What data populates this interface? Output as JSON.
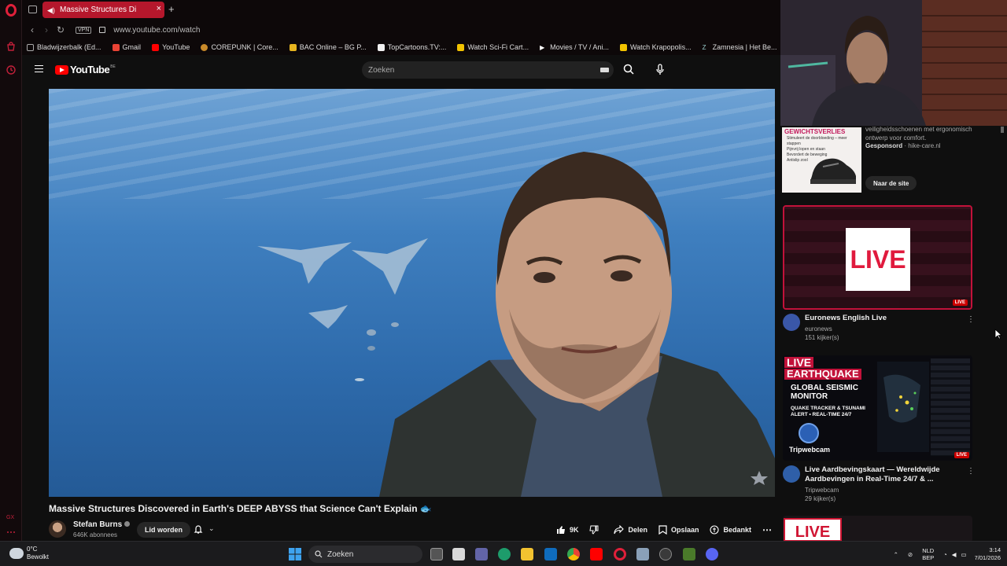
{
  "browser": {
    "tab_title": "Massive Structures Di",
    "url": "www.youtube.com/watch",
    "vpn_label": "VPN",
    "bookmarks": [
      {
        "label": "Bladwijzerbalk (Ed..."
      },
      {
        "label": "Gmail"
      },
      {
        "label": "YouTube"
      },
      {
        "label": "COREPUNK | Core..."
      },
      {
        "label": "BAC Online – BG P..."
      },
      {
        "label": "TopCartoons.TV:..."
      },
      {
        "label": "Watch Sci-Fi Cart..."
      },
      {
        "label": "Movies / TV / Ani..."
      },
      {
        "label": "Watch Krapopolis..."
      },
      {
        "label": "Zamnesia | Het Be..."
      }
    ]
  },
  "youtube": {
    "logo_text": "YouTube",
    "logo_country": "BE",
    "search_placeholder": "Zoeken"
  },
  "video": {
    "title": "Massive Structures Discovered in Earth's DEEP ABYSS that Science Can't Explain 🐟",
    "channel": "Stefan Burns",
    "subscribers": "646K abonnees",
    "member_label": "Lid worden",
    "likes": "9K",
    "share_label": "Delen",
    "save_label": "Opslaan",
    "thanks_label": "Bedankt"
  },
  "ad": {
    "heading": "GEWICHTSVERLIES",
    "bullets": [
      "Stimuleert de doorbloeding – meer stappen",
      "Pijnvrij lopen en staan",
      "Bevordert de beweging",
      "Antislip zool"
    ],
    "desc": "veiligheidsschoenen met ergonomisch ontwerp voor comfort.",
    "sponsored": "Gesponsord",
    "domain": "hike-care.nl",
    "cta": "Naar de site"
  },
  "recommendations": [
    {
      "thumb_text": "LIVE",
      "badge": "LIVE",
      "title": "Euronews English Live",
      "channel": "euronews",
      "meta": "151 kijker(s)"
    },
    {
      "thumb_line1": "LIVE",
      "thumb_line2": "EARTHQUAKE",
      "thumb_line3": "GLOBAL SEISMIC MONITOR",
      "thumb_line4": "QUAKE TRACKER & TSUNAMI ALERT • REAL-TIME 24/7",
      "thumb_brand": "Tripwebcam",
      "badge": "LIVE",
      "title": "Live Aardbevingskaart — Wereldwijde Aardbevingen in Real-Time 24/7 & ...",
      "channel": "Tripwebcam",
      "meta": "29 kijker(s)"
    },
    {
      "thumb_text": "LIVE"
    }
  ],
  "taskbar": {
    "temp": "0°C",
    "weather": "Bewolkt",
    "search": "Zoeken",
    "lang1": "NLD",
    "lang2": "BEP",
    "time": "3:14",
    "date": "7/01/2026"
  },
  "colors": {
    "accent": "#b5172c",
    "yt_red": "#ff0000",
    "bg": "#0f0f0f"
  }
}
